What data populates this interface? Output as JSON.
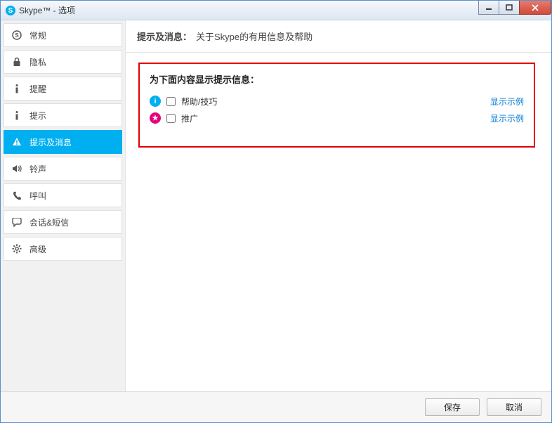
{
  "window": {
    "title": "Skype™ - 选项"
  },
  "sidebar": {
    "items": [
      {
        "label": "常规"
      },
      {
        "label": "隐私"
      },
      {
        "label": "提醒"
      },
      {
        "label": "提示"
      },
      {
        "label": "提示及消息"
      },
      {
        "label": "铃声"
      },
      {
        "label": "呼叫"
      },
      {
        "label": "会话&短信"
      },
      {
        "label": "高级"
      }
    ]
  },
  "header": {
    "title": "提示及消息：",
    "subtitle": "关于Skype的有用信息及帮助"
  },
  "section": {
    "title": "为下面内容显示提示信息：",
    "items": [
      {
        "label": "帮助/技巧",
        "link": "显示示例"
      },
      {
        "label": "推广",
        "link": "显示示例"
      }
    ]
  },
  "footer": {
    "save": "保存",
    "cancel": "取消"
  }
}
